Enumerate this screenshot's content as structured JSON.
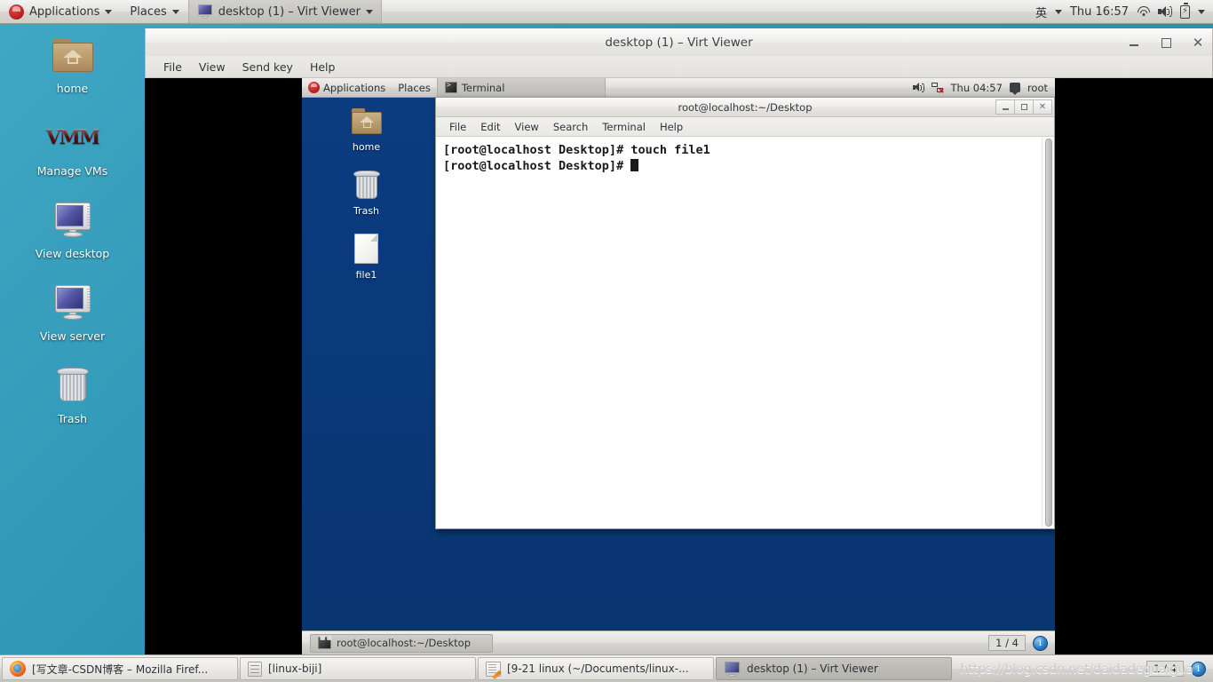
{
  "host": {
    "top_panel": {
      "applications_label": "Applications",
      "places_label": "Places",
      "window_task_label": "desktop (1) – Virt Viewer",
      "input_method": "英",
      "clock": "Thu 16:57"
    },
    "desktop_icons": [
      {
        "label": "home",
        "icon": "home-folder-icon"
      },
      {
        "label": "Manage VMs",
        "icon": "virt-manager-icon",
        "logo_text": "VMM"
      },
      {
        "label": "View desktop",
        "icon": "monitor-icon"
      },
      {
        "label": "View server",
        "icon": "monitor-icon"
      },
      {
        "label": "Trash",
        "icon": "trash-icon"
      }
    ],
    "taskbar": {
      "items": [
        {
          "label": "[写文章-CSDN博客 – Mozilla Firef...",
          "icon": "firefox-icon",
          "active": false
        },
        {
          "label": "[linux-biji]",
          "icon": "files-icon",
          "active": false
        },
        {
          "label": "[9-21 linux (~/Documents/linux-...",
          "icon": "gedit-icon",
          "active": false
        },
        {
          "label": "desktop (1) – Virt Viewer",
          "icon": "monitor-icon",
          "active": true
        }
      ],
      "workspace_indicator": "1 / 4",
      "notification_badge": "i"
    },
    "watermark": "https://blog.csdn.net/daidadeguaigua"
  },
  "virt_viewer": {
    "title": "desktop (1) – Virt Viewer",
    "menu": [
      "File",
      "View",
      "Send key",
      "Help"
    ],
    "window_buttons": {
      "minimize": "minimize-button",
      "maximize": "maximize-button",
      "close": "close-button"
    }
  },
  "guest": {
    "top_panel": {
      "applications_label": "Applications",
      "places_label": "Places",
      "window_task_label": "Terminal",
      "clock": "Thu 04:57",
      "user": "root"
    },
    "desktop_icons": [
      {
        "label": "home",
        "icon": "home-folder-icon"
      },
      {
        "label": "Trash",
        "icon": "trash-icon"
      },
      {
        "label": "file1",
        "icon": "document-icon"
      }
    ],
    "terminal": {
      "title": "root@localhost:~/Desktop",
      "menu": [
        "File",
        "Edit",
        "View",
        "Search",
        "Terminal",
        "Help"
      ],
      "lines": [
        "[root@localhost Desktop]# touch file1",
        "[root@localhost Desktop]# "
      ],
      "line1": "[root@localhost Desktop]# touch file1",
      "line2": "[root@localhost Desktop]# "
    },
    "bottom_panel": {
      "task_label": "root@localhost:~/Desktop",
      "workspace_indicator": "1 / 4",
      "notification_badge": "i"
    }
  },
  "colors": {
    "host_desktop": "#2d93b3",
    "guest_desktop": "#0a3a7c",
    "panel": "#e2e1de",
    "terminal_bg": "#ffffff",
    "terminal_fg": "#1a1a1a"
  }
}
